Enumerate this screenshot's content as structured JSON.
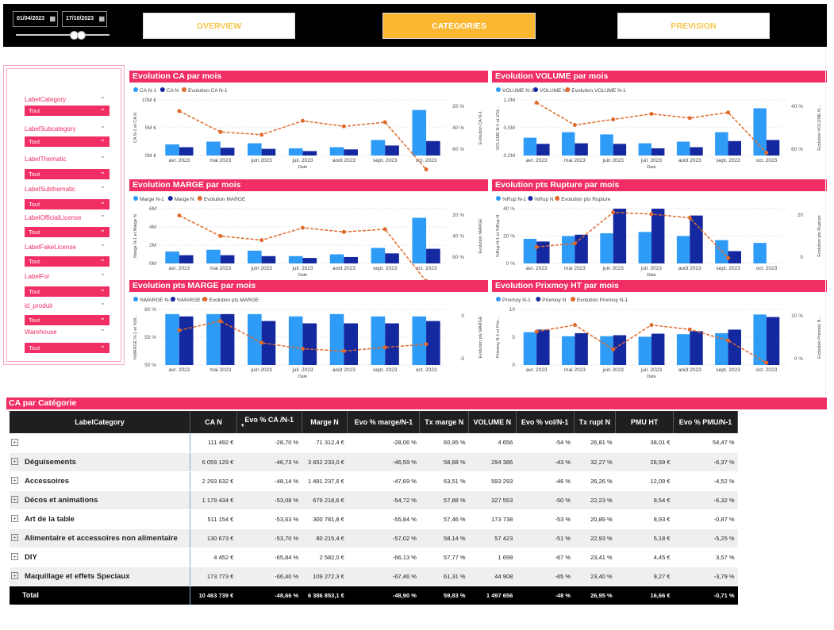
{
  "topbar": {
    "date_start": "01/04/2023",
    "date_end": "17/10/2023",
    "calendar_icon": "calendar-icon",
    "range_handles": 2
  },
  "nav": [
    {
      "label": "OVERVIEW",
      "active": false
    },
    {
      "label": "CATEGORIES",
      "active": true
    },
    {
      "label": "PREVISION",
      "active": false
    }
  ],
  "filters": [
    {
      "label": "LabelCategory",
      "value": "Tout"
    },
    {
      "label": "LabelSubcategory",
      "value": "Tout"
    },
    {
      "label": "LabelThematic",
      "value": "Tout"
    },
    {
      "label": "LabelSubthematic",
      "value": "Tout"
    },
    {
      "label": "LabelOfficialLicense",
      "value": "Tout"
    },
    {
      "label": "LabelFakeLicense",
      "value": "Tout"
    },
    {
      "label": "LabelFor",
      "value": "Tout"
    },
    {
      "label": "id_produit",
      "value": "Tout"
    },
    {
      "label": "Warehouse",
      "value": "Tout"
    }
  ],
  "colors": {
    "prev": "#2E9BF7",
    "cur": "#1428A0",
    "evo": "#E06A2B",
    "accent": "#F02E63",
    "nav_active": "#FBB731"
  },
  "chart_data": [
    {
      "type": "bar",
      "title": "Evolution CA par mois",
      "xlabel": "Date",
      "ylabel": "CA N-1 et CA N",
      "y2label": "Evolution CA N-1",
      "categories": [
        "avr. 2023",
        "mai 2023",
        "juin 2023",
        "juil. 2023",
        "août 2023",
        "sept. 2023",
        "oct. 2023"
      ],
      "yticks": [
        "10M €",
        "5M €",
        "0M €"
      ],
      "ylim": [
        0,
        10
      ],
      "y2ticks": [
        "20 %",
        "40 %",
        "60 %"
      ],
      "y2lim": [
        20,
        60
      ],
      "series": [
        {
          "name": "CA N-1",
          "values": [
            2.0,
            2.5,
            2.2,
            1.3,
            1.5,
            2.8,
            8.2
          ]
        },
        {
          "name": "CA N",
          "values": [
            1.5,
            1.4,
            1.2,
            0.8,
            1.1,
            1.8,
            2.6
          ]
        },
        {
          "name": "Evolution CA N-1",
          "values": [
            -28,
            -43,
            -45,
            -35,
            -39,
            -36,
            -70
          ]
        }
      ]
    },
    {
      "type": "bar",
      "title": "Evolution VOLUME par mois",
      "xlabel": "Date",
      "ylabel": "VOLUME N-1 et VOL...",
      "y2label": "Evolution VOLUME N...",
      "categories": [
        "avr. 2023",
        "mai 2023",
        "juin 2023",
        "juil. 2023",
        "août 2023",
        "sept. 2023",
        "oct. 2023"
      ],
      "yticks": [
        "1,0M",
        "0,5M",
        "0,0M"
      ],
      "ylim": [
        0,
        1
      ],
      "y2ticks": [
        "40 %",
        "60 %"
      ],
      "y2lim": [
        30,
        70
      ],
      "series": [
        {
          "name": "VOLUME N-1",
          "values": [
            0.32,
            0.42,
            0.38,
            0.22,
            0.25,
            0.42,
            0.85
          ]
        },
        {
          "name": "VOLUME N",
          "values": [
            0.21,
            0.22,
            0.21,
            0.13,
            0.15,
            0.26,
            0.28
          ]
        },
        {
          "name": "Evolution VOLUME N-1",
          "values": [
            -32,
            -48,
            -44,
            -40,
            -43,
            -39,
            -68
          ]
        }
      ]
    },
    {
      "type": "bar",
      "title": "Evolution MARGE par mois",
      "xlabel": "Date",
      "ylabel": "Marge N-1 et Marge N",
      "y2label": "Evolution MARGE",
      "categories": [
        "avr. 2023",
        "mai 2023",
        "juin 2023",
        "juil. 2023",
        "août 2023",
        "sept. 2023",
        "oct. 2023"
      ],
      "yticks": [
        "6M",
        "4M",
        "2M",
        "0M"
      ],
      "ylim": [
        0,
        6
      ],
      "y2ticks": [
        "20 %",
        "40 %",
        "60 %"
      ],
      "y2lim": [
        20,
        60
      ],
      "series": [
        {
          "name": "Marge N-1",
          "values": [
            1.3,
            1.5,
            1.4,
            0.8,
            1.0,
            1.7,
            5.0
          ]
        },
        {
          "name": "Marge N",
          "values": [
            0.9,
            0.9,
            0.8,
            0.6,
            0.7,
            1.1,
            1.6
          ]
        },
        {
          "name": "Evolution MARGE",
          "values": [
            -25,
            -40,
            -43,
            -34,
            -37,
            -35,
            -73
          ]
        }
      ]
    },
    {
      "type": "bar",
      "title": "Evolution pts Rupture par mois",
      "xlabel": "Date",
      "ylabel": "%Rup N-1 et %Rup N",
      "y2label": "Evolution pts Rupture",
      "categories": [
        "avr. 2023",
        "mai 2023",
        "juin 2023",
        "juil. 2023",
        "août 2023",
        "sept. 2023",
        "oct. 2023"
      ],
      "yticks": [
        "40 %",
        "20 %",
        "0 %"
      ],
      "ylim": [
        0,
        40
      ],
      "y2ticks": [
        "20",
        "0"
      ],
      "y2lim": [
        -10,
        20
      ],
      "series": [
        {
          "name": "%Rup N-1",
          "values": [
            18,
            20,
            22,
            23,
            20,
            17,
            15
          ]
        },
        {
          "name": "%Rup N",
          "values": [
            16,
            21,
            40,
            40,
            35,
            9,
            null
          ]
        },
        {
          "name": "Evolution pts Rupture",
          "values": [
            -1,
            1,
            18,
            17,
            15,
            -7,
            null
          ]
        }
      ]
    },
    {
      "type": "bar",
      "title": "Evolution pts MARGE par mois",
      "xlabel": "Date",
      "ylabel": "%MARGE N-1 et %M...",
      "y2label": "Evolution pts MARGE",
      "categories": [
        "avr. 2023",
        "mai 2023",
        "juin 2023",
        "juil. 2023",
        "août 2023",
        "sept. 2023",
        "oct. 2023"
      ],
      "yticks": [
        "60 %",
        "55 %",
        "50 %"
      ],
      "ylim": [
        50,
        62
      ],
      "y2ticks": [
        "0",
        "-5"
      ],
      "y2lim": [
        -8,
        4
      ],
      "series": [
        {
          "name": "%MARGE N-1",
          "values": [
            61,
            61,
            61,
            60.5,
            61,
            60.5,
            60.5
          ]
        },
        {
          "name": "%MARGE N",
          "values": [
            60.5,
            61,
            59.5,
            59,
            59,
            59,
            59.5
          ]
        },
        {
          "name": "Evolution pts MARGE",
          "values": [
            -0.5,
            1.5,
            -3.2,
            -4.5,
            -5.0,
            -4.2,
            -3.5
          ]
        }
      ]
    },
    {
      "type": "bar",
      "title": "Evolution Prixmoy HT par mois",
      "xlabel": "Date",
      "ylabel": "Prixmoy N-1 et Prix...",
      "y2label": "Evolution Prixmoy N...",
      "categories": [
        "avr. 2023",
        "mai 2023",
        "juin 2023",
        "juil. 2023",
        "août 2023",
        "sept. 2023",
        "oct. 2023"
      ],
      "yticks": [
        "10",
        "5",
        "0"
      ],
      "ylim": [
        0,
        11
      ],
      "y2ticks": [
        "10 %",
        "0 %"
      ],
      "y2lim": [
        -5,
        20
      ],
      "series": [
        {
          "name": "Prixmoy N-1",
          "values": [
            6.5,
            5.7,
            5.7,
            5.6,
            6.1,
            6.3,
            10
          ]
        },
        {
          "name": "Prixmoy N",
          "values": [
            7.0,
            6.3,
            5.9,
            6.2,
            6.7,
            7.0,
            9.5
          ]
        },
        {
          "name": "Evolution Prixmoy N-1",
          "values": [
            10,
            13,
            2,
            13,
            11,
            6,
            -4
          ]
        }
      ]
    }
  ],
  "table": {
    "title": "CA par Catégorie",
    "columns": [
      "LabelCategory",
      "CA N",
      "Evo % CA /N-1",
      "Marge N",
      "Evo % marge/N-1",
      "Tx marge N",
      "VOLUME N",
      "Evo % vol/N-1",
      "Tx rupt N",
      "PMU HT",
      "Evo % PMU/N-1"
    ],
    "rows": [
      [
        "",
        "111 492 €",
        "-28,70 %",
        "71 312,4 €",
        "-28,06 %",
        "60,95 %",
        "4 656",
        "-54 %",
        "26,81 %",
        "38,01 €",
        "54,47 %"
      ],
      [
        "Déguisements",
        "6 059 129 €",
        "-46,73 %",
        "3 652 233,0 €",
        "-46,59 %",
        "58,88 %",
        "294 386",
        "-43 %",
        "32,27 %",
        "28,59 €",
        "-6,37 %"
      ],
      [
        "Accessoires",
        "2 293 632 €",
        "-48,14 %",
        "1 491 237,6 €",
        "-47,69 %",
        "63,51 %",
        "593 293",
        "-46 %",
        "26,26 %",
        "12,09 €",
        "-4,52 %"
      ],
      [
        "Décos et animations",
        "1 179 434 €",
        "-53,08 %",
        "679 218,6 €",
        "-54,72 %",
        "57,88 %",
        "327 553",
        "-50 %",
        "22,23 %",
        "9,54 €",
        "-6,32 %"
      ],
      [
        "Art de la table",
        "511 154 €",
        "-53,63 %",
        "300 781,8 €",
        "-55,84 %",
        "57,46 %",
        "173 738",
        "-53 %",
        "20,89 %",
        "8,93 €",
        "-0,87 %"
      ],
      [
        "Alimentaire et accessoires non alimentaire",
        "130 673 €",
        "-53,70 %",
        "80 215,4 €",
        "-57,02 %",
        "58,14 %",
        "57 423",
        "-51 %",
        "22,93 %",
        "5,18 €",
        "-5,25 %"
      ],
      [
        "DIY",
        "4 452 €",
        "-65,84 %",
        "2 582,0 €",
        "-66,13 %",
        "57,77 %",
        "1 699",
        "-67 %",
        "23,41 %",
        "4,45 €",
        "3,57 %"
      ],
      [
        "Maquillage et effets Speciaux",
        "173 773 €",
        "-66,40 %",
        "109 272,3 €",
        "-67,46 %",
        "61,31 %",
        "44 908",
        "-65 %",
        "23,40 %",
        "9,27 €",
        "-3,79 %"
      ]
    ],
    "total": [
      "Total",
      "10 463 739 €",
      "-48,66 %",
      "6 386 853,1 €",
      "-48,90 %",
      "59,83 %",
      "1 497 656",
      "-48 %",
      "26,95 %",
      "16,66 €",
      "-0,71 %"
    ]
  }
}
